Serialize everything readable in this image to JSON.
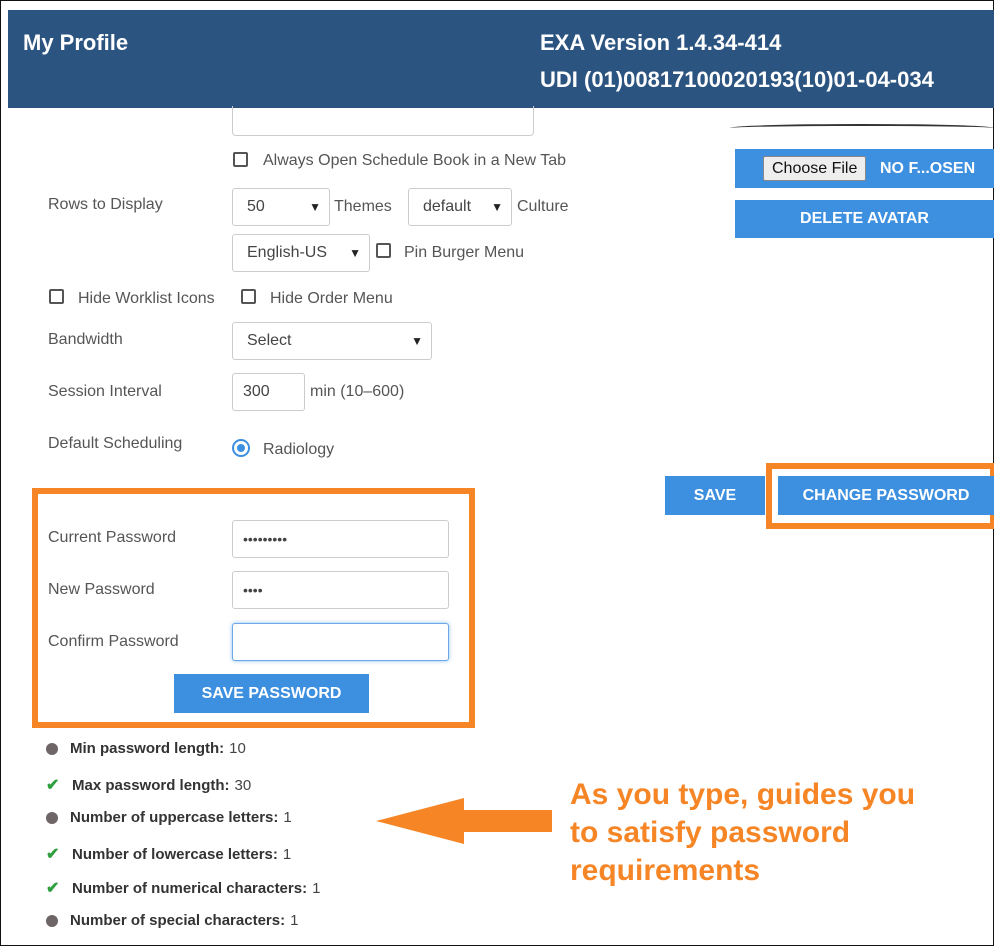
{
  "header": {
    "title": "My Profile",
    "version": "EXA Version 1.4.34-414",
    "udi": "UDI (01)00817100020193(10)01-04-034"
  },
  "settings": {
    "always_open_label": "Always Open Schedule Book in a New Tab",
    "rows_label": "Rows to Display",
    "rows_value": "50",
    "themes_label": "Themes",
    "themes_value": "default",
    "culture_label": "Culture",
    "culture_value": "English-US",
    "pin_burger_label": "Pin Burger Menu",
    "hide_worklist_label": "Hide Worklist Icons",
    "hide_order_label": "Hide Order Menu",
    "bandwidth_label": "Bandwidth",
    "bandwidth_value": "Select",
    "session_label": "Session Interval",
    "session_value": "300",
    "session_hint": "min (10–600)",
    "default_sched_label": "Default Scheduling",
    "default_sched_value": "Radiology"
  },
  "avatar": {
    "choose_file": "Choose File",
    "no_file": "NO F...OSEN",
    "delete": "DELETE AVATAR"
  },
  "actions": {
    "save": "SAVE",
    "change_password": "CHANGE PASSWORD"
  },
  "password": {
    "current_label": "Current Password",
    "current_value": "•••••••••",
    "new_label": "New Password",
    "new_value": "••••",
    "confirm_label": "Confirm Password",
    "confirm_value": "",
    "save_button": "SAVE PASSWORD"
  },
  "requirements": [
    {
      "label": "Min password length:",
      "value": "10",
      "status": "pending"
    },
    {
      "label": "Max password length:",
      "value": "30",
      "status": "met"
    },
    {
      "label": "Number of uppercase letters:",
      "value": "1",
      "status": "pending"
    },
    {
      "label": "Number of lowercase letters:",
      "value": "1",
      "status": "met"
    },
    {
      "label": "Number of numerical characters:",
      "value": "1",
      "status": "met"
    },
    {
      "label": "Number of special characters:",
      "value": "1",
      "status": "pending"
    }
  ],
  "annotation": {
    "line1": "As you type, guides you",
    "line2": "to satisfy password",
    "line3": "requirements"
  },
  "colors": {
    "header": "#2c5480",
    "button": "#3d8fe0",
    "highlight": "#f68526",
    "met": "#2e9e3e",
    "pending": "#6e6567"
  },
  "icons": {
    "met": "checkmark-icon",
    "pending": "dot-icon",
    "select": "chevron-down-icon",
    "radio": "radio-selected-icon",
    "annotation": "arrow-left-icon"
  }
}
